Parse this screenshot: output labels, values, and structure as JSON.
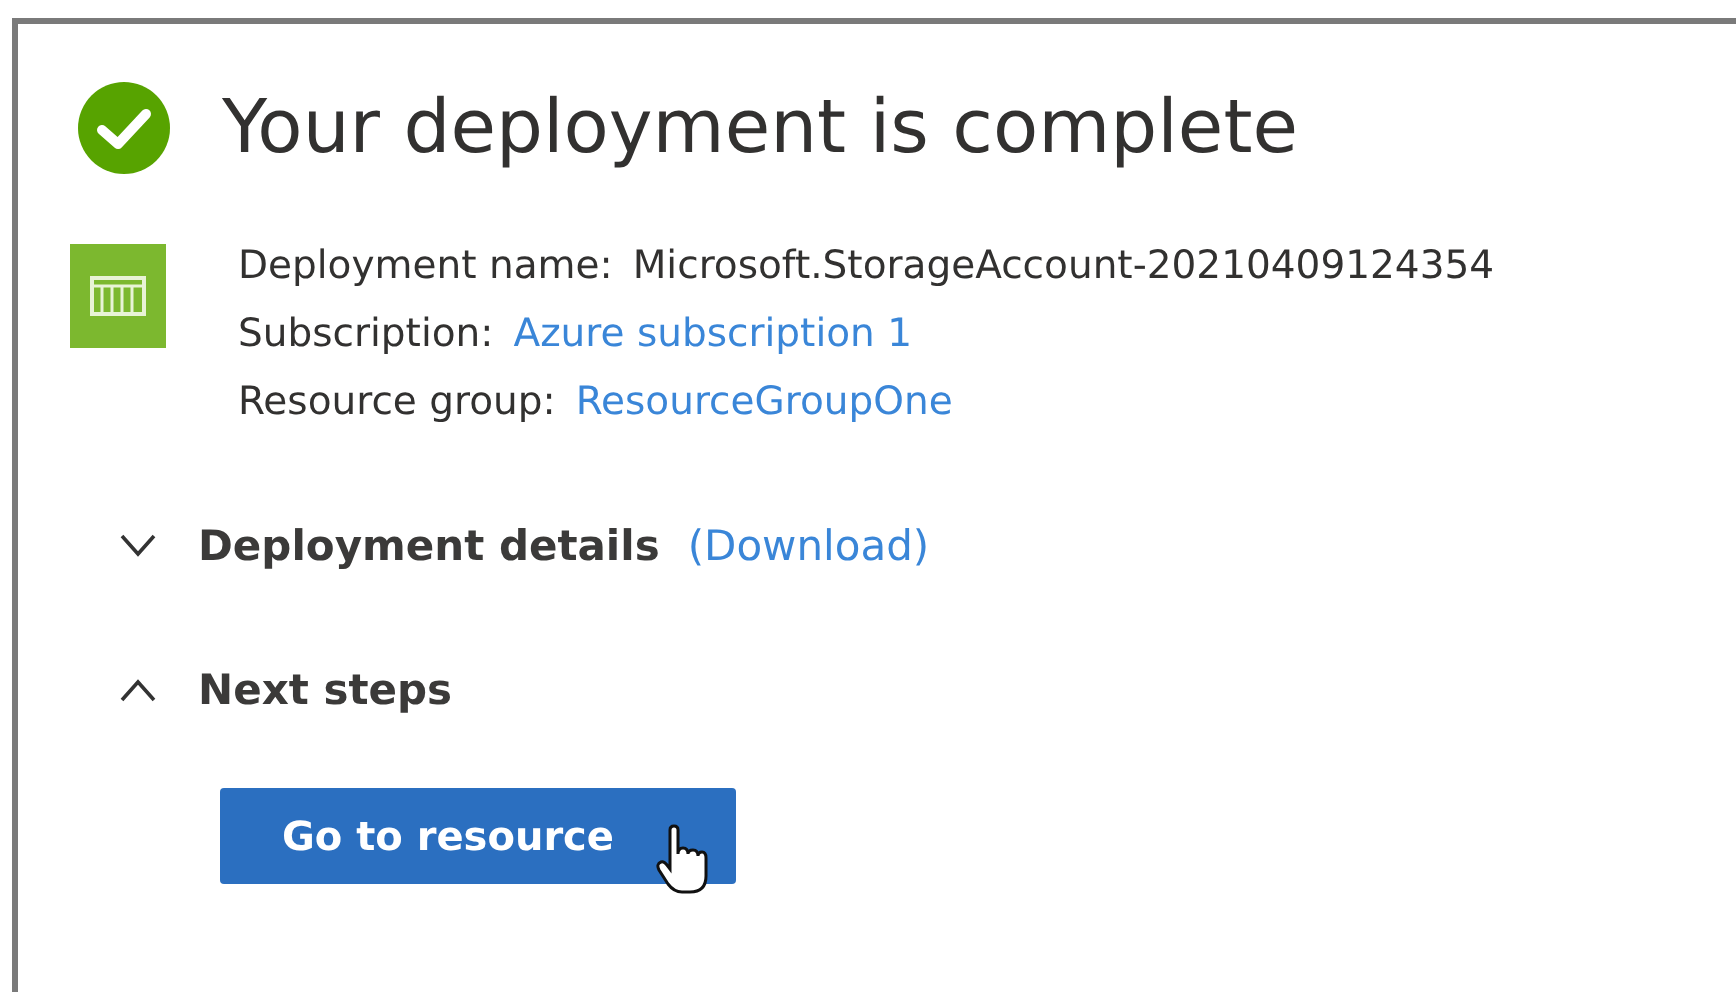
{
  "status": {
    "kind": "success",
    "title": "Your deployment is complete"
  },
  "details": [
    {
      "label": "Deployment name:",
      "value": "Microsoft.StorageAccount-20210409124354",
      "kind": "text"
    },
    {
      "label": "Subscription:",
      "value": "Azure subscription 1",
      "kind": "link"
    },
    {
      "label": "Resource group:",
      "value": "ResourceGroupOne",
      "kind": "link"
    }
  ],
  "sections": [
    {
      "title": "Deployment details",
      "link": "(Download)",
      "expanded": false
    },
    {
      "title": "Next steps",
      "expanded": true
    }
  ],
  "primary_button": {
    "label": "Go to resource"
  }
}
